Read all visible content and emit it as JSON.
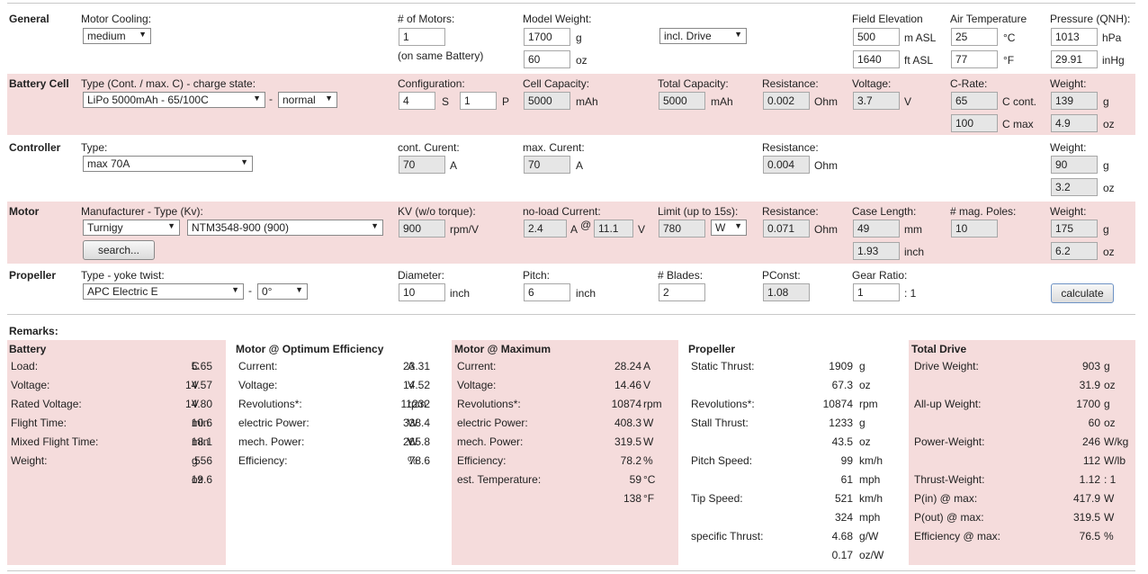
{
  "general": {
    "section": "General",
    "motor_cooling_label": "Motor Cooling:",
    "motor_cooling_value": "medium",
    "num_motors_label": "# of Motors:",
    "num_motors_value": "1",
    "num_motors_note": "(on same Battery)",
    "model_weight_label": "Model Weight:",
    "model_weight_g": "1700",
    "model_weight_oz": "60",
    "unit_g": "g",
    "unit_oz": "oz",
    "weight_mode": "incl. Drive",
    "field_elevation_label": "Field Elevation",
    "field_elevation_m": "500",
    "field_elevation_m_unit": "m ASL",
    "field_elevation_ft": "1640",
    "field_elevation_ft_unit": "ft ASL",
    "air_temp_label": "Air Temperature",
    "air_temp_c": "25",
    "air_temp_c_unit": "°C",
    "air_temp_f": "77",
    "air_temp_f_unit": "°F",
    "pressure_label": "Pressure (QNH):",
    "pressure_hpa": "1013",
    "pressure_hpa_unit": "hPa",
    "pressure_inhg": "29.91",
    "pressure_inhg_unit": "inHg"
  },
  "battery": {
    "section": "Battery Cell",
    "type_label": "Type (Cont. / max. C) - charge state:",
    "type_value": "LiPo 5000mAh - 65/100C",
    "dash": "-",
    "charge_state": "normal",
    "config_label": "Configuration:",
    "config_s": "4",
    "config_s_unit": "S",
    "config_p": "1",
    "config_p_unit": "P",
    "cell_capacity_label": "Cell Capacity:",
    "cell_capacity_value": "5000",
    "cell_capacity_unit": "mAh",
    "total_capacity_label": "Total Capacity:",
    "total_capacity_value": "5000",
    "total_capacity_unit": "mAh",
    "resistance_label": "Resistance:",
    "resistance_value": "0.002",
    "resistance_unit": "Ohm",
    "voltage_label": "Voltage:",
    "voltage_value": "3.7",
    "voltage_unit": "V",
    "crate_label": "C-Rate:",
    "crate_cont": "65",
    "crate_cont_unit": "C cont.",
    "crate_max": "100",
    "crate_max_unit": "C max",
    "weight_label": "Weight:",
    "weight_g": "139",
    "weight_oz": "4.9"
  },
  "controller": {
    "section": "Controller",
    "type_label": "Type:",
    "type_value": "max 70A",
    "cont_current_label": "cont. Curent:",
    "cont_current_value": "70",
    "max_current_label": "max. Curent:",
    "max_current_value": "70",
    "current_unit": "A",
    "resistance_label": "Resistance:",
    "resistance_value": "0.004",
    "resistance_unit": "Ohm",
    "weight_label": "Weight:",
    "weight_g": "90",
    "weight_oz": "3.2"
  },
  "motor": {
    "section": "Motor",
    "mfr_label": "Manufacturer - Type (Kv):",
    "manufacturer": "Turnigy",
    "model": "NTM3548-900 (900)",
    "search_label": "search...",
    "kv_label": "KV (w/o torque):",
    "kv_value": "900",
    "kv_unit": "rpm/V",
    "noload_label": "no-load Current:",
    "noload_current": "2.4",
    "noload_current_unit": "A",
    "at_symbol": "@",
    "noload_voltage": "11.1",
    "noload_voltage_unit": "V",
    "limit_label": "Limit (up to 15s):",
    "limit_value": "780",
    "limit_unit": "W",
    "resistance_label": "Resistance:",
    "resistance_value": "0.071",
    "resistance_unit": "Ohm",
    "case_length_label": "Case Length:",
    "case_length_mm": "49",
    "case_length_mm_unit": "mm",
    "case_length_inch": "1.93",
    "case_length_inch_unit": "inch",
    "mag_poles_label": "# mag. Poles:",
    "mag_poles_value": "10",
    "weight_label": "Weight:",
    "weight_g": "175",
    "weight_oz": "6.2"
  },
  "propeller": {
    "section": "Propeller",
    "type_label": "Type - yoke twist:",
    "type_value": "APC Electric E",
    "dash": "-",
    "twist_value": "0°",
    "diameter_label": "Diameter:",
    "diameter_value": "10",
    "pitch_label": "Pitch:",
    "pitch_value": "6",
    "inch_unit": "inch",
    "blades_label": "# Blades:",
    "blades_value": "2",
    "pconst_label": "PConst:",
    "pconst_value": "1.08",
    "gear_label": "Gear Ratio:",
    "gear_value": "1",
    "gear_suffix": ": 1",
    "calculate_label": "calculate"
  },
  "remarks_label": "Remarks:",
  "results": {
    "battery": {
      "title": "Battery",
      "rows": [
        {
          "label": "Load:",
          "value": "5.65",
          "unit": "C"
        },
        {
          "label": "Voltage:",
          "value": "14.57",
          "unit": "V"
        },
        {
          "label": "Rated Voltage:",
          "value": "14.80",
          "unit": "V"
        },
        {
          "label": "Flight Time:",
          "value": "10.6",
          "unit": "min"
        },
        {
          "label": "Mixed Flight Time:",
          "value": "18.1",
          "unit": "min"
        },
        {
          "label": "Weight:",
          "value": "556",
          "unit": "g"
        },
        {
          "label": "",
          "value": "19.6",
          "unit": "oz"
        }
      ]
    },
    "opt": {
      "title": "Motor @ Optimum Efficiency",
      "rows": [
        {
          "label": "Current:",
          "value": "23.31",
          "unit": "A"
        },
        {
          "label": "Voltage:",
          "value": "14.52",
          "unit": "V"
        },
        {
          "label": "Revolutions*:",
          "value": "11232",
          "unit": "rpm"
        },
        {
          "label": "electric Power:",
          "value": "338.4",
          "unit": "W"
        },
        {
          "label": "mech. Power:",
          "value": "265.8",
          "unit": "W"
        },
        {
          "label": "Efficiency:",
          "value": "78.6",
          "unit": "%"
        }
      ]
    },
    "max": {
      "title": "Motor @ Maximum",
      "rows": [
        {
          "label": "Current:",
          "value": "28.24",
          "unit": "A"
        },
        {
          "label": "Voltage:",
          "value": "14.46",
          "unit": "V"
        },
        {
          "label": "Revolutions*:",
          "value": "10874",
          "unit": "rpm"
        },
        {
          "label": "electric Power:",
          "value": "408.3",
          "unit": "W"
        },
        {
          "label": "mech. Power:",
          "value": "319.5",
          "unit": "W"
        },
        {
          "label": "Efficiency:",
          "value": "78.2",
          "unit": "%"
        },
        {
          "label": "est. Temperature:",
          "value": "59",
          "unit": "°C"
        },
        {
          "label": "",
          "value": "138",
          "unit": "°F"
        }
      ]
    },
    "prop": {
      "title": "Propeller",
      "rows": [
        {
          "label": "Static Thrust:",
          "value": "1909",
          "unit": "g"
        },
        {
          "label": "",
          "value": "67.3",
          "unit": "oz"
        },
        {
          "label": "Revolutions*:",
          "value": "10874",
          "unit": "rpm"
        },
        {
          "label": "Stall Thrust:",
          "value": "1233",
          "unit": "g"
        },
        {
          "label": "",
          "value": "43.5",
          "unit": "oz"
        },
        {
          "label": "Pitch Speed:",
          "value": "99",
          "unit": "km/h"
        },
        {
          "label": "",
          "value": "61",
          "unit": "mph"
        },
        {
          "label": "Tip Speed:",
          "value": "521",
          "unit": "km/h"
        },
        {
          "label": "",
          "value": "324",
          "unit": "mph"
        },
        {
          "label": "specific Thrust:",
          "value": "4.68",
          "unit": "g/W"
        },
        {
          "label": "",
          "value": "0.17",
          "unit": "oz/W"
        }
      ]
    },
    "total": {
      "title": "Total Drive",
      "rows": [
        {
          "label": "Drive Weight:",
          "value": "903",
          "unit": "g"
        },
        {
          "label": "",
          "value": "31.9",
          "unit": "oz"
        },
        {
          "label": "All-up Weight:",
          "value": "1700",
          "unit": "g"
        },
        {
          "label": "",
          "value": "60",
          "unit": "oz"
        },
        {
          "label": "Power-Weight:",
          "value": "246",
          "unit": "W/kg"
        },
        {
          "label": "",
          "value": "112",
          "unit": "W/lb"
        },
        {
          "label": "Thrust-Weight:",
          "value": "1.12",
          "unit": ": 1"
        },
        {
          "label": "P(in) @ max:",
          "value": "417.9",
          "unit": "W"
        },
        {
          "label": "P(out) @ max:",
          "value": "319.5",
          "unit": "W"
        },
        {
          "label": "Efficiency @ max:",
          "value": "76.5",
          "unit": "%"
        }
      ]
    }
  }
}
